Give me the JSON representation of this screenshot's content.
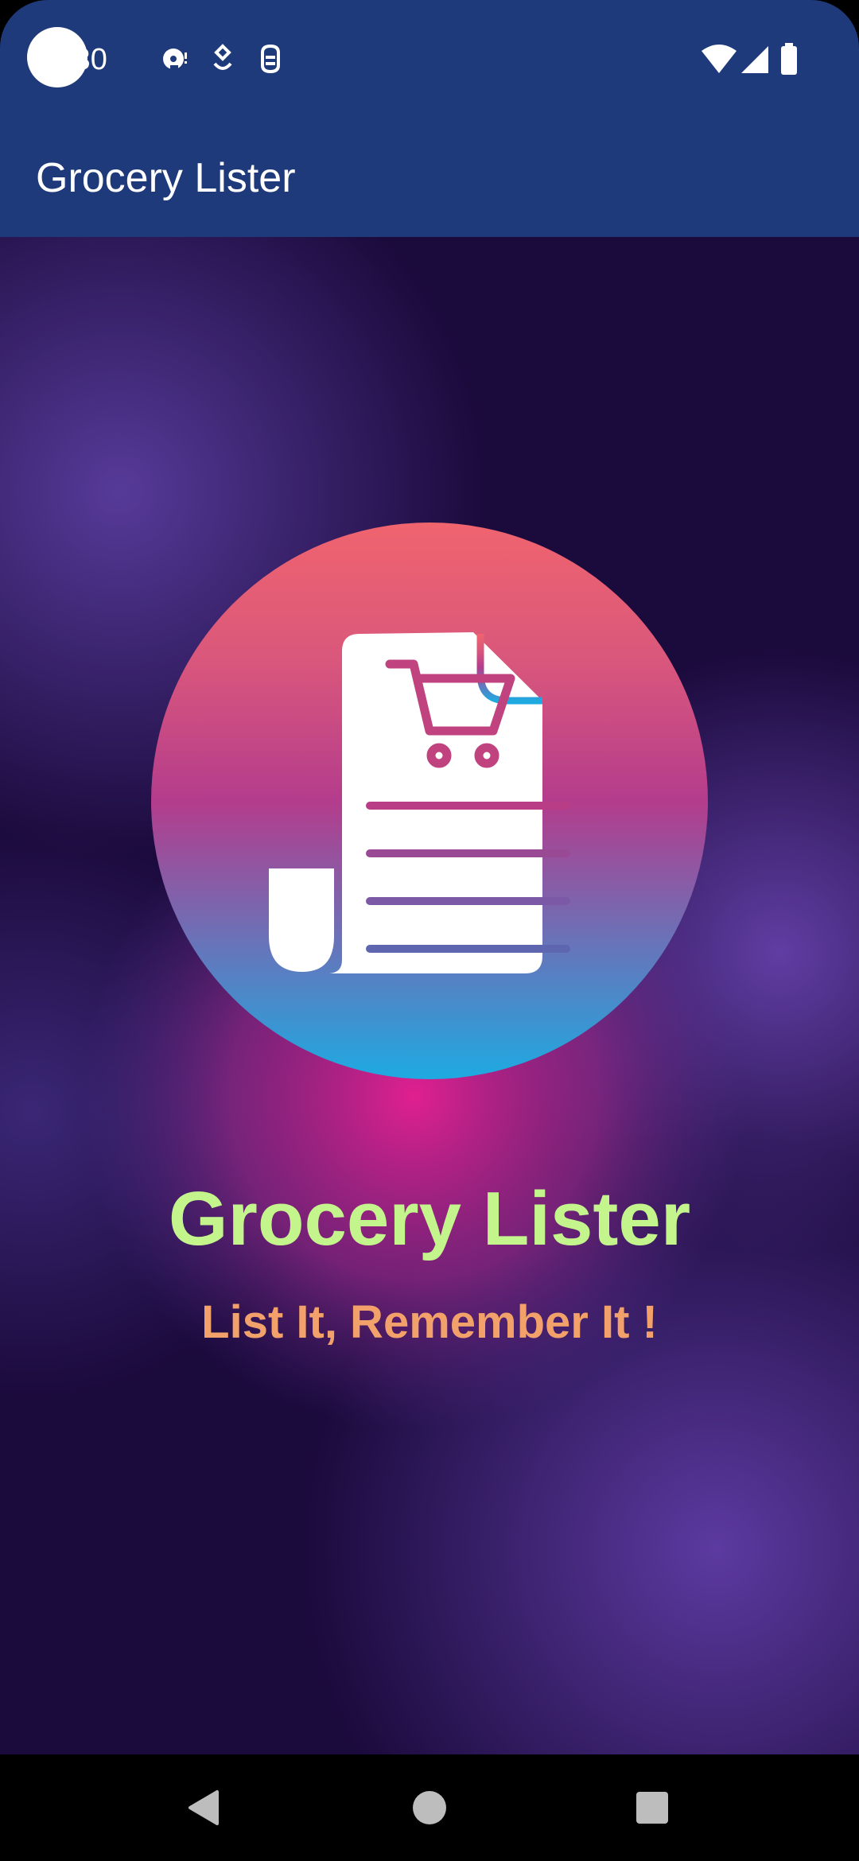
{
  "status_bar": {
    "time": ":30",
    "left_icons": [
      "media-icon",
      "location-pin-icon",
      "debug-icon"
    ],
    "right_icons": [
      "wifi-icon",
      "cell-signal-icon",
      "battery-icon"
    ]
  },
  "app_bar": {
    "title": "Grocery Lister"
  },
  "splash": {
    "logo_icon": "grocery-list-cart-icon",
    "title": "Grocery Lister",
    "tagline": "List It, Remember It !"
  },
  "nav_bar": {
    "buttons": [
      "back-icon",
      "home-icon",
      "recents-icon"
    ]
  },
  "colors": {
    "app_bar": "#1e3a7b",
    "title_green": "#c4f58d",
    "tagline_orange": "#f3a16b",
    "logo_gradient_top": "#f0646e",
    "logo_gradient_mid": "#b43c8c",
    "logo_gradient_bottom": "#1eaae1",
    "cart_magenta": "#c0437f"
  }
}
